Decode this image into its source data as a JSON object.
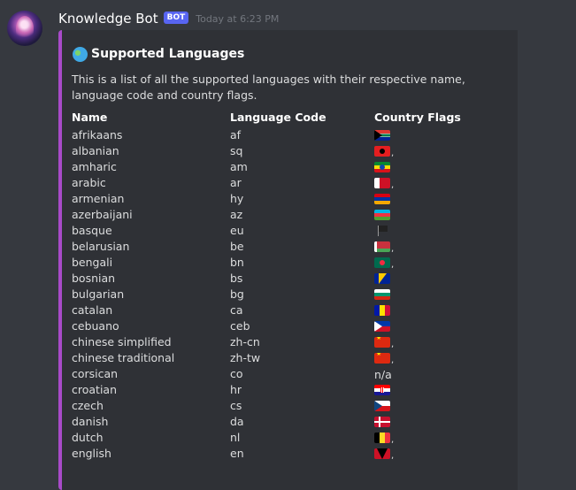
{
  "message": {
    "author": "Knowledge Bot",
    "badge": "BOT",
    "timestamp": "Today at 6:23 PM",
    "avatar_icon": "anime-avatar-icon"
  },
  "embed": {
    "accent_color": "#a84ac9",
    "title_icon": "globe-icon",
    "title": "Supported Languages",
    "description": "This is a list of all the supported languages with their respective name, language code and country flags.",
    "columns": {
      "name": "Name",
      "code": "Language Code",
      "flags": "Country Flags"
    },
    "rows": [
      {
        "name": "afrikaans",
        "code": "af",
        "flag": "south-africa-flag-icon",
        "comma": ""
      },
      {
        "name": "albanian",
        "code": "sq",
        "flag": "albania-flag-icon",
        "comma": ","
      },
      {
        "name": "amharic",
        "code": "am",
        "flag": "ethiopia-flag-icon",
        "comma": ""
      },
      {
        "name": "arabic",
        "code": "ar",
        "flag": "bahrain-flag-icon",
        "comma": ","
      },
      {
        "name": "armenian",
        "code": "hy",
        "flag": "armenia-flag-icon",
        "comma": ""
      },
      {
        "name": "azerbaijani",
        "code": "az",
        "flag": "azerbaijan-flag-icon",
        "comma": ""
      },
      {
        "name": "basque",
        "code": "eu",
        "flag": "black-flag-icon",
        "comma": ""
      },
      {
        "name": "belarusian",
        "code": "be",
        "flag": "belarus-flag-icon",
        "comma": ","
      },
      {
        "name": "bengali",
        "code": "bn",
        "flag": "bangladesh-flag-icon",
        "comma": ","
      },
      {
        "name": "bosnian",
        "code": "bs",
        "flag": "bosnia-flag-icon",
        "comma": ""
      },
      {
        "name": "bulgarian",
        "code": "bg",
        "flag": "bulgaria-flag-icon",
        "comma": ""
      },
      {
        "name": "catalan",
        "code": "ca",
        "flag": "andorra-flag-icon",
        "comma": ""
      },
      {
        "name": "cebuano",
        "code": "ceb",
        "flag": "philippines-flag-icon",
        "comma": ""
      },
      {
        "name": "chinese simplified",
        "code": "zh-cn",
        "flag": "china-flag-icon",
        "comma": ","
      },
      {
        "name": "chinese traditional",
        "code": "zh-tw",
        "flag": "china-flag-icon",
        "comma": ","
      },
      {
        "name": "corsican",
        "code": "co",
        "flag": "",
        "flag_text": "n/a",
        "comma": ""
      },
      {
        "name": "croatian",
        "code": "hr",
        "flag": "croatia-flag-icon",
        "comma": ""
      },
      {
        "name": "czech",
        "code": "cs",
        "flag": "czech-flag-icon",
        "comma": ""
      },
      {
        "name": "danish",
        "code": "da",
        "flag": "denmark-flag-icon",
        "comma": ""
      },
      {
        "name": "dutch",
        "code": "nl",
        "flag": "belgium-flag-icon",
        "comma": ","
      },
      {
        "name": "english",
        "code": "en",
        "flag": "antigua-flag-icon",
        "comma": ","
      }
    ]
  }
}
